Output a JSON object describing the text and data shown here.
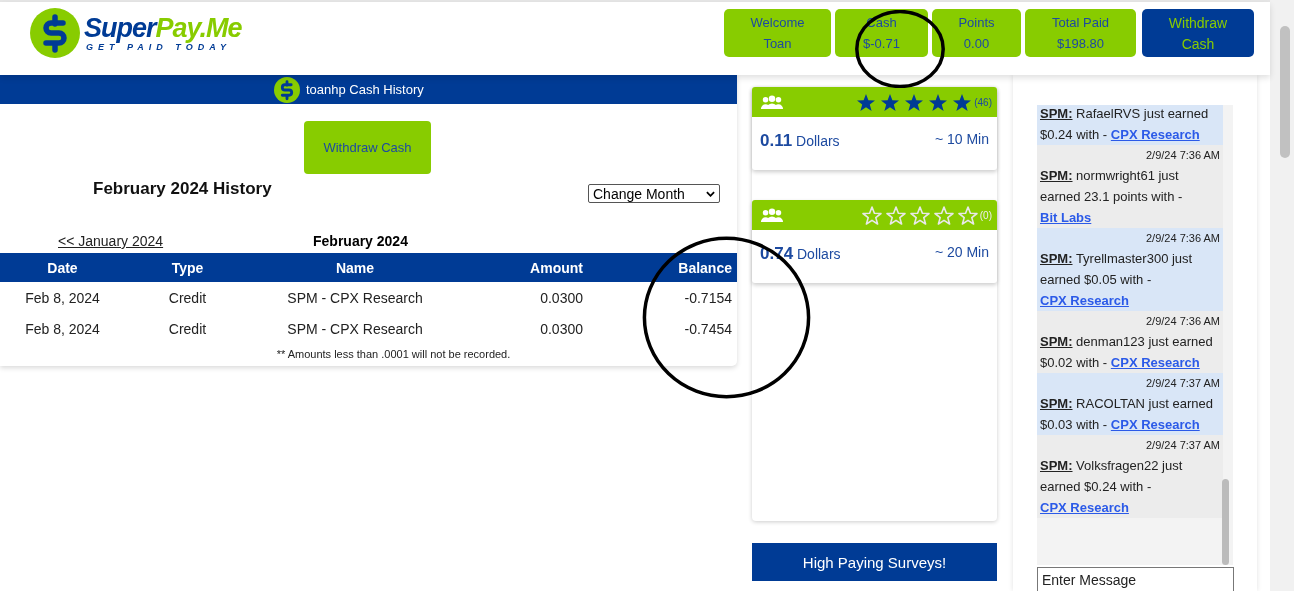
{
  "header": {
    "brand_first": "Super",
    "brand_second": "Pay.Me",
    "tagline": "GET PAID TODAY",
    "stats": [
      {
        "kind": "stat",
        "label": "Welcome",
        "value": "Toan"
      },
      {
        "kind": "stat",
        "label": "Cash",
        "value": "$-0.71"
      },
      {
        "kind": "stat",
        "label": "Points",
        "value": "0.00"
      },
      {
        "kind": "stat",
        "label": "Total Paid",
        "value": "$198.80"
      },
      {
        "kind": "action",
        "label": "Withdraw",
        "value": "Cash"
      }
    ]
  },
  "history": {
    "title": "toanhp Cash History",
    "withdraw_button": "Withdraw Cash",
    "heading": "February 2024 History",
    "month_select": "Change Month",
    "prev_link": "<< January 2024",
    "current_month": "February 2024",
    "table": {
      "columns": [
        "Date",
        "Type",
        "Name",
        "Amount",
        "Balance"
      ],
      "rows": [
        [
          "Feb 8, 2024",
          "Credit",
          "SPM - CPX Research",
          "0.0300",
          "-0.7154"
        ],
        [
          "Feb 8, 2024",
          "Credit",
          "SPM - CPX Research",
          "0.0300",
          "-0.7454"
        ]
      ]
    },
    "footnote": "** Amounts less than .0001 will not be recorded."
  },
  "surveys": [
    {
      "stars": 5,
      "count": "(46)",
      "amount": "0.11",
      "unit": "Dollars",
      "duration": "~ 10 Min"
    },
    {
      "stars": 0,
      "count": "(0)",
      "amount": "0.74",
      "unit": "Dollars",
      "duration": "~ 20 Min"
    }
  ],
  "promo_button": "High Paying Surveys!",
  "chat": {
    "messages": [
      {
        "highlighted": true,
        "sender": "SPM:",
        "text": "RafaelRVS just earned $0.24 with -",
        "link": "CPX Research"
      },
      {
        "highlighted": false,
        "time": "2/9/24 7:36 AM",
        "sender": "SPM:",
        "text": "normwright61 just earned 23.1 points with -",
        "link": "Bit Labs"
      },
      {
        "highlighted": true,
        "time": "2/9/24 7:36 AM",
        "sender": "SPM:",
        "text": "Tyrellmaster300 just earned $0.05 with -",
        "link": "CPX Research"
      },
      {
        "highlighted": false,
        "time": "2/9/24 7:36 AM",
        "sender": "SPM:",
        "text": "denman123 just earned $0.02 with -",
        "link": "CPX Research"
      },
      {
        "highlighted": true,
        "time": "2/9/24 7:37 AM",
        "sender": "SPM:",
        "text": "RACOLTAN just earned $0.03 with -",
        "link": "CPX Research"
      },
      {
        "highlighted": false,
        "time": "2/9/24 7:37 AM",
        "sender": "SPM:",
        "text": "Volksfragen22 just earned $0.24 with -",
        "link": "CPX Research"
      }
    ],
    "input": {
      "placeholder": "Enter Message"
    }
  },
  "annotations": [
    {
      "kind": "circle"
    },
    {
      "kind": "circle"
    }
  ]
}
